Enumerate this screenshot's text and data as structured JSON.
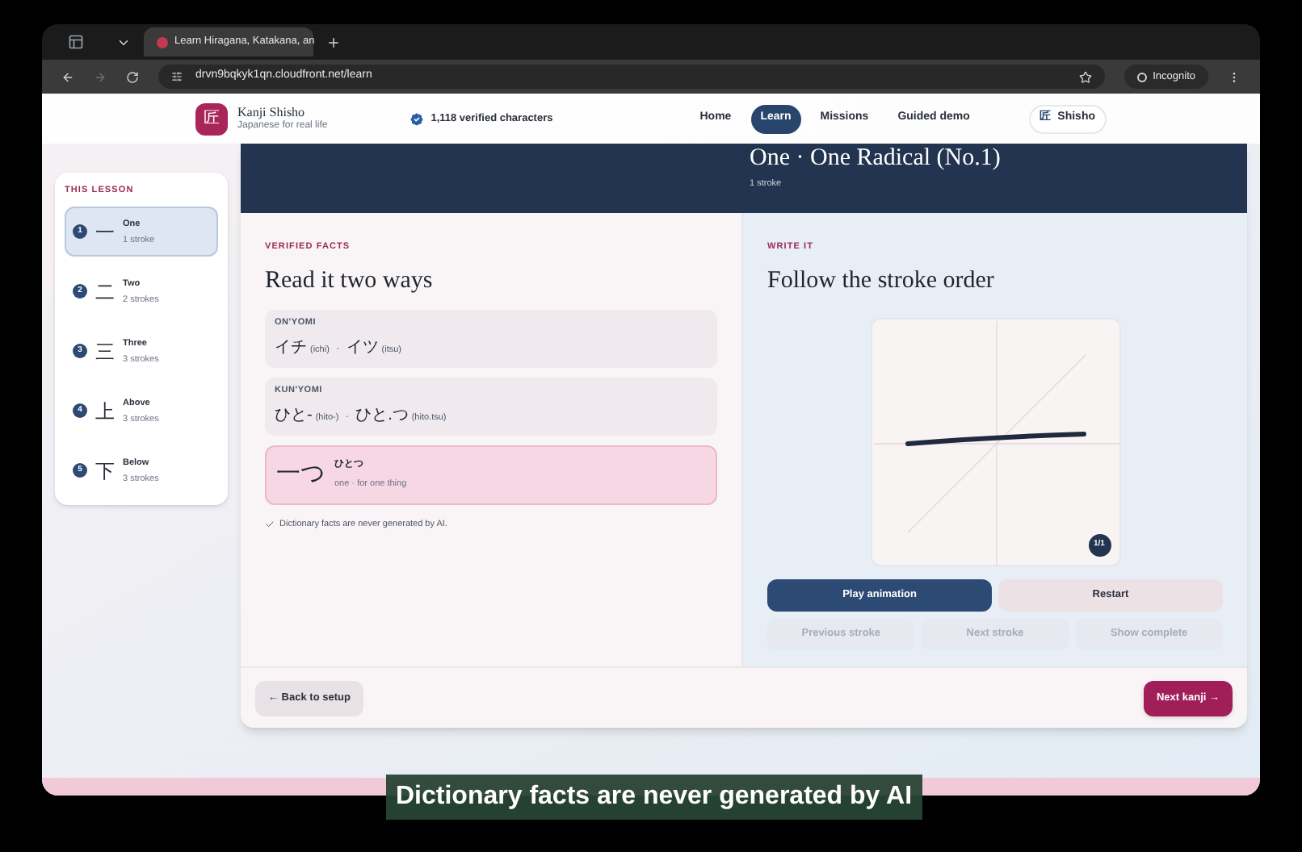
{
  "browser": {
    "tabs": [
      {
        "title": "Learn Hiragana, Katakana, an",
        "selected": true
      }
    ],
    "url": "drvn9bqkyk1qn.cloudfront.net/learn",
    "profile": "Incognito"
  },
  "site_header": {
    "logo_glyph": "匠",
    "brand": "Kanji Shisho",
    "tagline": "Japanese for real life",
    "verified": "1,118 verified characters",
    "nav": [
      {
        "label": "Home",
        "selected": false
      },
      {
        "label": "Learn",
        "selected": true
      },
      {
        "label": "Missions",
        "selected": false
      },
      {
        "label": "Guided demo",
        "selected": false
      }
    ],
    "account": {
      "glyph": "匠",
      "label": "Shisho"
    }
  },
  "lesson": {
    "heading": "THIS LESSON",
    "items": [
      {
        "number": "1",
        "kanji": "一",
        "name": "One",
        "strokes": "1 stroke",
        "selected": true
      },
      {
        "number": "2",
        "kanji": "二",
        "name": "Two",
        "strokes": "2 strokes",
        "selected": false
      },
      {
        "number": "3",
        "kanji": "三",
        "name": "Three",
        "strokes": "3 strokes",
        "selected": false
      },
      {
        "number": "4",
        "kanji": "上",
        "name": "Above",
        "strokes": "3 strokes",
        "selected": false
      },
      {
        "number": "5",
        "kanji": "下",
        "name": "Below",
        "strokes": "3 strokes",
        "selected": false
      }
    ]
  },
  "banner": {
    "title": "One · One Radical (No.1)",
    "strokes": "1 stroke"
  },
  "facts": {
    "eyebrow": "VERIFIED FACTS",
    "heading": "Read it two ways",
    "separator": "·",
    "readings": [
      {
        "label": "ON'YOMI",
        "items": [
          {
            "kana": "イチ",
            "romaji": "(ichi)"
          },
          {
            "kana": "イツ",
            "romaji": "(itsu)"
          }
        ]
      },
      {
        "label": "KUN'YOMI",
        "items": [
          {
            "kana": "ひと-",
            "romaji": "(hito-)"
          },
          {
            "kana": "ひと.つ",
            "romaji": "(hito.tsu)"
          }
        ]
      }
    ],
    "word": {
      "text": "一つ",
      "reading": "ひとつ",
      "meaning": "one · for one thing"
    },
    "note": "Dictionary facts are never generated by AI."
  },
  "write": {
    "eyebrow": "WRITE IT",
    "heading": "Follow the stroke order",
    "counter": "1/1",
    "buttons": [
      {
        "label": "Play animation",
        "kind": "primary"
      },
      {
        "label": "Restart",
        "kind": "secondary"
      },
      {
        "label": "Previous stroke",
        "kind": "disabled"
      },
      {
        "label": "Next stroke",
        "kind": "disabled"
      },
      {
        "label": "Show complete",
        "kind": "disabled"
      }
    ]
  },
  "footer": {
    "back": "← Back to setup",
    "next": "Next kanji →"
  },
  "caption": "Dictionary facts are never generated by AI"
}
